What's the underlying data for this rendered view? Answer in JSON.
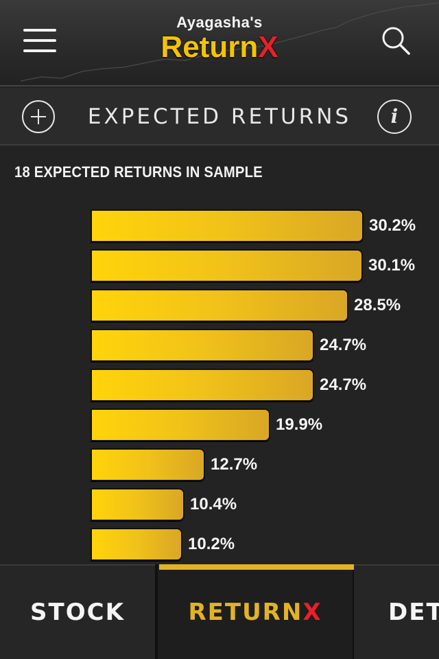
{
  "header": {
    "brand_owner": "Ayagasha's",
    "brand_name_main": "Return",
    "brand_name_x": "X",
    "menu_icon": "hamburger-menu-icon",
    "search_icon": "search-icon"
  },
  "subbar": {
    "title": "EXPECTED RETURNS",
    "add_icon": "plus-circle-icon",
    "info_icon": "info-icon",
    "info_glyph": "i"
  },
  "sample_label": "18 EXPECTED RETURNS IN SAMPLE",
  "chart_data": {
    "type": "bar",
    "orientation": "horizontal",
    "values": [
      30.2,
      30.1,
      28.5,
      24.7,
      24.7,
      19.9,
      12.7,
      10.4,
      10.2
    ],
    "labels": [
      "30.2%",
      "30.1%",
      "28.5%",
      "24.7%",
      "24.7%",
      "19.9%",
      "12.7%",
      "10.4%",
      "10.2%"
    ],
    "xlim": [
      0,
      30.2
    ],
    "grid": false,
    "bar_color": "#f5c400"
  },
  "tabs": [
    {
      "label": "STOCK"
    },
    {
      "label_main": "RETURN",
      "label_x": "X",
      "active": true
    },
    {
      "label": "DET"
    }
  ],
  "colors": {
    "accent": "#e3b324",
    "brand_red": "#e8202a",
    "background": "#232323"
  }
}
